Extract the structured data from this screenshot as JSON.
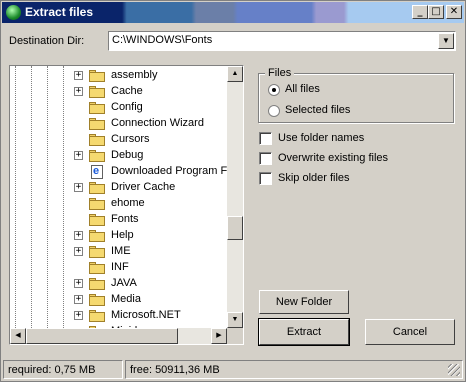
{
  "window": {
    "title": "Extract files",
    "minimize": "_",
    "maximize": "□",
    "close": "✕"
  },
  "destination": {
    "label": "Destination Dir:",
    "value": "C:\\WINDOWS\\Fonts"
  },
  "tree": {
    "items": [
      {
        "label": "assembly",
        "expandable": true,
        "icon": "folder-icon"
      },
      {
        "label": "Cache",
        "expandable": true,
        "icon": "folder-icon"
      },
      {
        "label": "Config",
        "expandable": false,
        "icon": "folder-icon"
      },
      {
        "label": "Connection Wizard",
        "expandable": false,
        "icon": "folder-icon"
      },
      {
        "label": "Cursors",
        "expandable": false,
        "icon": "folder-icon"
      },
      {
        "label": "Debug",
        "expandable": true,
        "icon": "folder-icon"
      },
      {
        "label": "Downloaded Program Fil",
        "expandable": false,
        "icon": "ie-document-icon"
      },
      {
        "label": "Driver Cache",
        "expandable": true,
        "icon": "folder-icon"
      },
      {
        "label": "ehome",
        "expandable": false,
        "icon": "folder-icon"
      },
      {
        "label": "Fonts",
        "expandable": false,
        "icon": "folder-icon"
      },
      {
        "label": "Help",
        "expandable": true,
        "icon": "folder-icon"
      },
      {
        "label": "IME",
        "expandable": true,
        "icon": "folder-icon"
      },
      {
        "label": "INF",
        "expandable": false,
        "icon": "folder-icon"
      },
      {
        "label": "JAVA",
        "expandable": true,
        "icon": "folder-icon"
      },
      {
        "label": "Media",
        "expandable": true,
        "icon": "folder-icon"
      },
      {
        "label": "Microsoft.NET",
        "expandable": true,
        "icon": "folder-icon"
      },
      {
        "label": "Minidump",
        "expandable": false,
        "icon": "folder-icon"
      }
    ]
  },
  "files_group": {
    "title": "Files",
    "options": [
      {
        "label": "All files",
        "selected": true
      },
      {
        "label": "Selected files",
        "selected": false
      }
    ]
  },
  "checkboxes": [
    {
      "label": "Use folder names",
      "checked": false
    },
    {
      "label": "Overwrite existing files",
      "checked": false
    },
    {
      "label": "Skip older files",
      "checked": false
    }
  ],
  "buttons": {
    "new_folder": "New Folder",
    "extract": "Extract",
    "cancel": "Cancel"
  },
  "status": {
    "required": "required: 0,75 MB",
    "free": "free: 50911,36 MB"
  }
}
